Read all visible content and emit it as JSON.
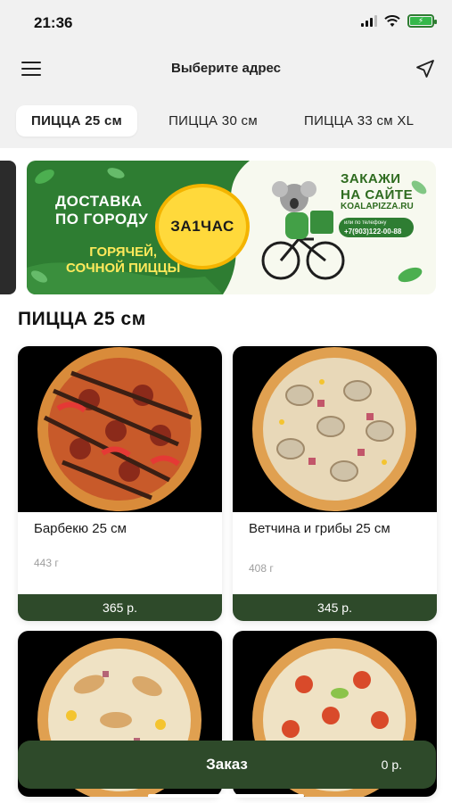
{
  "status_bar": {
    "time": "21:36"
  },
  "header": {
    "title": "Выберите адрес"
  },
  "tabs": [
    {
      "label": "ПИЦЦА 25 см",
      "active": true
    },
    {
      "label": "ПИЦЦА 30 см",
      "active": false
    },
    {
      "label": "ПИЦЦА 33 см XL",
      "active": false
    }
  ],
  "banner": {
    "delivery_line1": "ДОСТАВКА",
    "delivery_line2": "ПО ГОРОДУ",
    "hot_line1": "ГОРЯЧЕЙ,",
    "hot_line2": "СОЧНОЙ ПИЦЦЫ",
    "time_badge": "ЗА1ЧАС",
    "order_line1": "ЗАКАЖИ",
    "order_line2": "НА САЙТЕ",
    "site": "KOALAPIZZA.RU",
    "phone_caption": "или по телефону",
    "phone": "+7(903)122-00-88",
    "mascot_label": "KOALA"
  },
  "section": {
    "title": "ПИЦЦА 25 см"
  },
  "products": [
    {
      "name": "Барбекю 25 см",
      "weight": "443 г",
      "price": "365 р."
    },
    {
      "name": "Ветчина и грибы 25 см",
      "weight": "408 г",
      "price": "345 р."
    },
    {
      "name": "",
      "weight": "",
      "price": ""
    },
    {
      "name": "",
      "weight": "",
      "price": ""
    }
  ],
  "order": {
    "label": "Заказ",
    "total": "0 р."
  },
  "colors": {
    "brand_green": "#2e4a2a",
    "banner_green": "#2e7d32",
    "accent_yellow": "#ffd93b"
  }
}
